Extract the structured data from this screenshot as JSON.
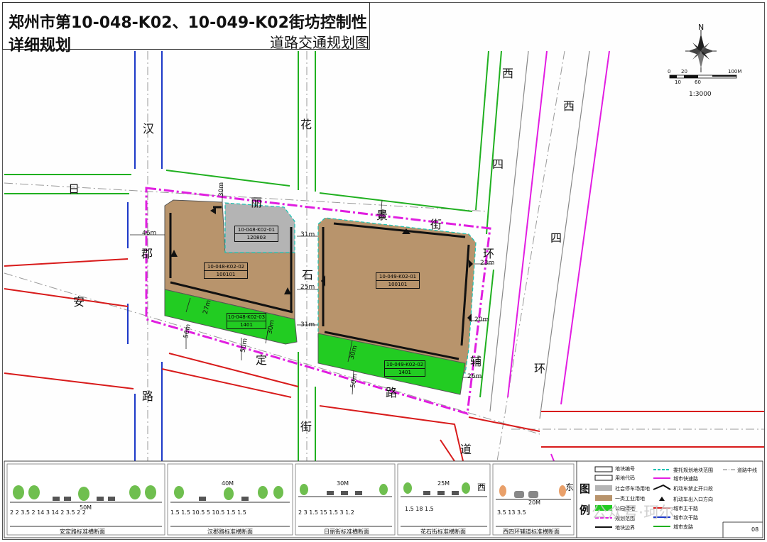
{
  "title": {
    "main": "郑州市第10-048-K02、10-049-K02街坊控制性详细规划",
    "sub": "道路交通规划图"
  },
  "north": {
    "letter": "N",
    "scale_ticks": [
      "0",
      "20",
      "100M",
      "10",
      "60"
    ],
    "scale_text": "1:3000"
  },
  "roads": {
    "hanri": [
      "汉",
      "日"
    ],
    "yongan": [
      "安",
      "路"
    ],
    "hanjun": [
      "郡"
    ],
    "huashi": [
      "花",
      "石",
      "街"
    ],
    "lijing": [
      "丽",
      "景",
      "街"
    ],
    "andingroad": [
      "定",
      "路"
    ],
    "xisihuan_fu": [
      "西",
      "四",
      "环",
      "辅",
      "道"
    ],
    "xisihuan": [
      "西",
      "四",
      "环"
    ],
    "dong": "东",
    "xi": "西"
  },
  "dimensions": {
    "d1": "30m",
    "d2": "46m",
    "d3": "31m",
    "d4": "25m",
    "d5": "31m",
    "d6": "5m",
    "d7": "23m",
    "d8": "20m",
    "d9": "26m",
    "d10": "27m",
    "d11": "56m",
    "d12": "30m",
    "d13": "50m",
    "d14": "30m",
    "d15": "50m"
  },
  "parcels": [
    {
      "code": "10-048-K02-01",
      "land": "120803"
    },
    {
      "code": "10-048-K02-02",
      "land": "100101"
    },
    {
      "code": "10-048-K02-03",
      "land": "1401"
    },
    {
      "code": "10-049-K02-01",
      "land": "100101"
    },
    {
      "code": "10-049-K02-02",
      "land": "1401"
    }
  ],
  "sections": [
    {
      "width": "50M",
      "dims": "2 2 3.5 2   14   3   14   2 3.5 2 2",
      "name": "安定路标准横断面"
    },
    {
      "width": "40M",
      "dims": "1.5 1.5  10.5  5  10.5  1.5 1.5",
      "name": "汉郡路标准横断面"
    },
    {
      "width": "30M",
      "dims": "2 3 1.5   15   1.5 3 1.2",
      "name": "日丽街标准横断面"
    },
    {
      "width": "25M",
      "dims": "1.5   18   1.5",
      "name": "花石街标准横断面"
    },
    {
      "width": "20M",
      "dims": "3.5   13   3.5",
      "name": "西四环辅道标准横断面"
    }
  ],
  "legend": {
    "title": [
      "图",
      "例"
    ],
    "items": [
      "地块编号",
      "用地代码",
      "社会停车场用地",
      "一类工业用地",
      "公园绿地",
      "规划范围",
      "地块边界",
      "委托规划地块范围",
      "城市快速路",
      "机动车禁止开口段",
      "机动车出入口方向",
      "城市主干路",
      "城市次干路",
      "城市支路",
      "道路中线"
    ]
  },
  "page_number": "08",
  "watermark": "公众号·珂尔",
  "colors": {
    "industrial": "#b8946c",
    "green": "#22cc22",
    "parking": "#b4b4b4",
    "expressway": "#e21de2",
    "arterial": "#d81b1b",
    "secondary": "#1c39c8",
    "branch": "#20b020",
    "boundary": "#e01ee0",
    "entrusted": "#17c3b3"
  }
}
